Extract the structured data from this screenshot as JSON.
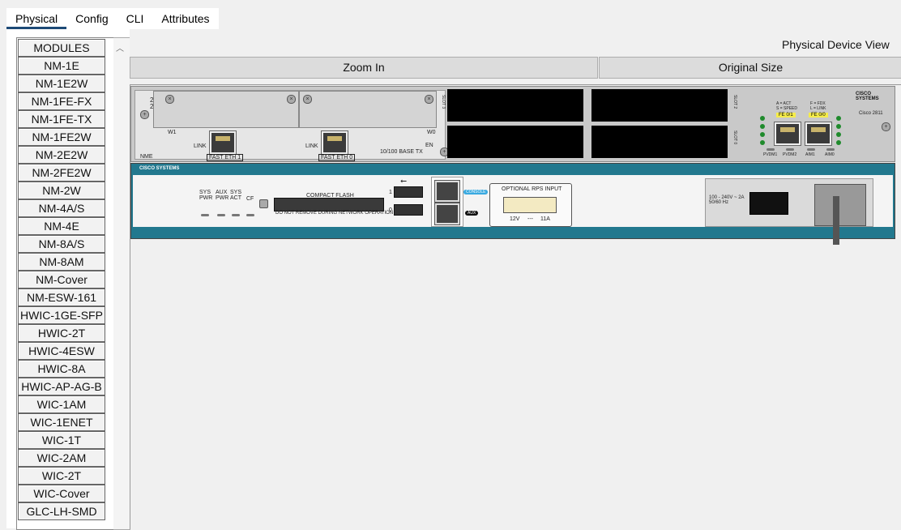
{
  "tabs": [
    "Physical",
    "Config",
    "CLI",
    "Attributes"
  ],
  "modules": [
    "MODULES",
    "NM-1E",
    "NM-1E2W",
    "NM-1FE-FX",
    "NM-1FE-TX",
    "NM-1FE2W",
    "NM-2E2W",
    "NM-2FE2W",
    "NM-2W",
    "NM-4A/S",
    "NM-4E",
    "NM-8A/S",
    "NM-8AM",
    "NM-Cover",
    "NM-ESW-161",
    "HWIC-1GE-SFP",
    "HWIC-2T",
    "HWIC-4ESW",
    "HWIC-8A",
    "HWIC-AP-AG-B",
    "WIC-1AM",
    "WIC-1ENET",
    "WIC-1T",
    "WIC-2AM",
    "WIC-2T",
    "WIC-Cover",
    "GLC-LH-SMD"
  ],
  "pane": {
    "title": "Physical Device View",
    "zoom_in": "Zoom In",
    "original_size": "Original Size"
  },
  "device": {
    "module_labels": {
      "nm_type": "2FE\n2W",
      "w1": "W1",
      "w0": "W0",
      "link1": "LINK",
      "link0": "LINK",
      "fe1": "FAST ETH 1",
      "fe0": "FAST ETH 0",
      "base_tx": "10/100 BASE TX",
      "en": "EN",
      "nme": "NME"
    },
    "slot_labels": {
      "slot3": "SLOT 3",
      "slot2": "SLOT 2",
      "slot0": "SLOT 0"
    },
    "led_legend": {
      "a_act": "A = ACT",
      "s_speed": "S = SPEED",
      "f_fdx": "F = FDX",
      "l_link": "L = LINK",
      "fe01": "FE 0/1",
      "fe00": "FE 0/0"
    },
    "bottom_labels": [
      "PVDM1",
      "PVDM2",
      "AIM1",
      "AIM0"
    ],
    "brand": "CISCO SYSTEMS",
    "model": "Cisco 2811",
    "front": {
      "status_labels": [
        "SYS\nPWR",
        "AUX\nPWR",
        "SYS\nACT",
        "CF"
      ],
      "compact_flash": "COMPACT FLASH",
      "cf_warning": "DO NOT REMOVE DURING NETWORK OPERATION",
      "usb1": "1",
      "usb0": "0",
      "console": "CONSOLE",
      "aux": "AUX",
      "rps_title": "OPTIONAL RPS INPUT",
      "rps_v": "12V",
      "rps_a": "11A",
      "rps_dc": "---",
      "power_rating": "100 - 240V ~ 2A\n50/60 Hz"
    }
  }
}
